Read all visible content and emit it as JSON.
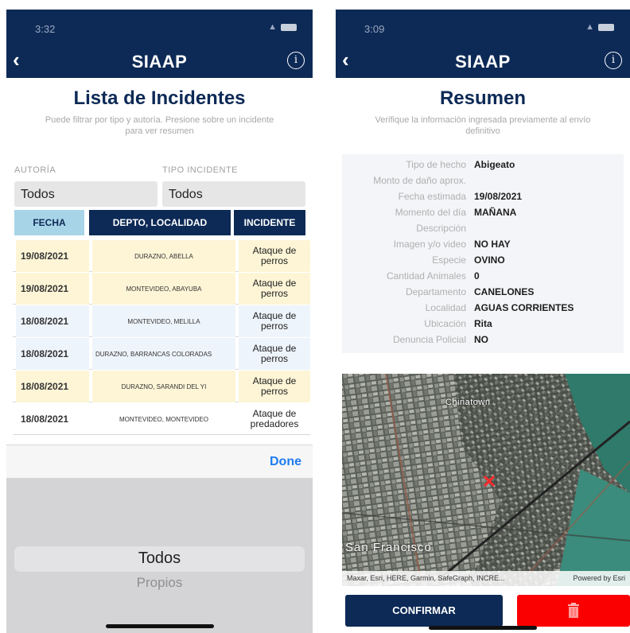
{
  "left": {
    "status_time": "3:32",
    "nav_title": "SIAAP",
    "heading": "Lista de Incidentes",
    "subtext": "Puede filtrar por tipo y autoría. Presione sobre un incidente para ver resumen",
    "filter_autoria_label": "AUTORÍA",
    "filter_autoria_value": "Todos",
    "filter_tipo_label": "TIPO INCIDENTE",
    "filter_tipo_value": "Todos",
    "table_headers": [
      "FECHA",
      "DEPTO, LOCALIDAD",
      "INCIDENTE"
    ],
    "rows": [
      {
        "date": "19/08/2021",
        "location": "DURAZNO, ABELLA",
        "incident": "Ataque de perros"
      },
      {
        "date": "19/08/2021",
        "location": "MONTEVIDEO, ABAYUBA",
        "incident": "Ataque de perros"
      },
      {
        "date": "18/08/2021",
        "location": "MONTEVIDEO, MELILLA",
        "incident": "Ataque de perros"
      },
      {
        "date": "18/08/2021",
        "location": "DURAZNO, BARRANCAS COLORADAS",
        "incident": "Ataque de perros"
      },
      {
        "date": "18/08/2021",
        "location": "DURAZNO, SARANDI DEL YI",
        "incident": "Ataque de perros"
      },
      {
        "date": "18/08/2021",
        "location": "MONTEVIDEO, MONTEVIDEO",
        "incident": "Ataque de predadores"
      }
    ],
    "done_label": "Done",
    "picker_options": [
      "Todos",
      "Propios"
    ]
  },
  "right": {
    "status_time": "3:09",
    "nav_title": "SIAAP",
    "heading": "Resumen",
    "subtext": "Verifique la información ingresada previamente al envío definitivo",
    "summary": [
      {
        "label": "Tipo de hecho",
        "value": "Abigeato"
      },
      {
        "label": "Monto de daño aprox.",
        "value": ""
      },
      {
        "label": "Fecha estimada",
        "value": "19/08/2021"
      },
      {
        "label": "Momento del día",
        "value": "MAÑANA"
      },
      {
        "label": "Descripción",
        "value": ""
      },
      {
        "label": "Imagen y/o video",
        "value": "NO HAY"
      },
      {
        "label": "Especie",
        "value": "OVINO"
      },
      {
        "label": "Cantidad Animales",
        "value": "0"
      },
      {
        "label": "Departamento",
        "value": "CANELONES"
      },
      {
        "label": "Localidad",
        "value": "AGUAS CORRIENTES"
      },
      {
        "label": "Ubicación",
        "value": "Rita"
      },
      {
        "label": "Denuncia Policial",
        "value": "NO"
      }
    ],
    "map_labels": {
      "chinatown": "Chinatown",
      "city": "San Francisco"
    },
    "map_attribution": "Maxar, Esri, HERE, Garmin, SafeGraph, INCRE...",
    "map_powered": "Powered by Esri",
    "confirm_label": "CONFIRMAR"
  },
  "colors": {
    "navy": "#0d2a56",
    "header_light": "#a8d4e8",
    "row_yellow": "#fdf5d6",
    "row_blue": "#eef4fb",
    "delete_red": "#fb0000",
    "link_blue": "#1e7bf2"
  },
  "icons": [
    "back-chevron-icon",
    "info-icon",
    "wifi-icon",
    "battery-icon",
    "trash-icon",
    "map-marker-icon"
  ]
}
